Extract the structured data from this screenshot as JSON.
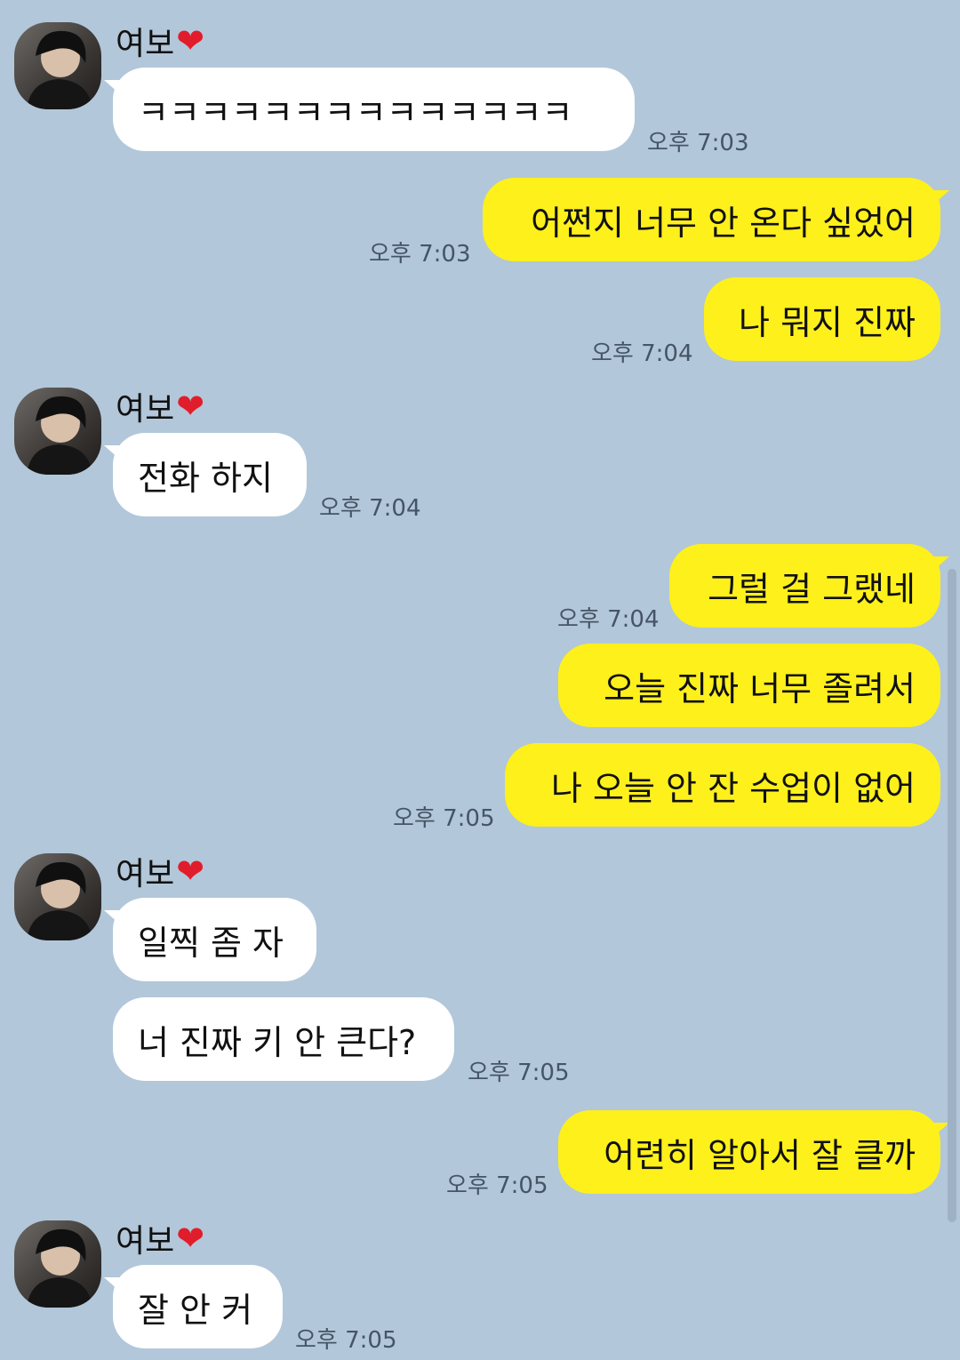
{
  "contact": {
    "name": "여보",
    "heart_icon": "❤"
  },
  "messages": [
    {
      "text": "ㅋㅋㅋㅋㅋㅋㅋㅋㅋㅋㅋㅋㅋㅋ",
      "time": "오후 7:03"
    },
    {
      "text": "어쩐지 너무 안 온다 싶었어",
      "time": "오후 7:03"
    },
    {
      "text": "나 뭐지 진짜",
      "time": "오후 7:04"
    },
    {
      "text": "전화 하지",
      "time": "오후 7:04"
    },
    {
      "text": "그럴 걸 그랬네",
      "time": "오후 7:04"
    },
    {
      "text": "오늘 진짜 너무 졸려서"
    },
    {
      "text": "나 오늘 안 잔 수업이 없어",
      "time": "오후 7:05"
    },
    {
      "text": "일찍 좀 자"
    },
    {
      "text": "너 진짜 키 안 큰다?",
      "time": "오후 7:05"
    },
    {
      "text": "어련히 알아서 잘 클까",
      "time": "오후 7:05"
    },
    {
      "text": "잘 안 커",
      "time": "오후 7:05"
    }
  ],
  "colors": {
    "background": "#b2c7d9",
    "incoming_bubble": "#ffffff",
    "outgoing_bubble": "#fef01b",
    "heart": "#e11d2b"
  }
}
